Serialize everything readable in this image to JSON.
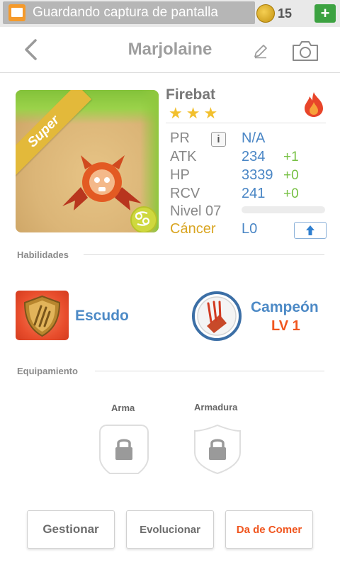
{
  "status_bar": {
    "toast_text": "Guardando captura de pantalla",
    "coins": "15",
    "plus_label": "+"
  },
  "header": {
    "title": "Marjolaine"
  },
  "creature": {
    "badge": "Super",
    "name": "Firebat",
    "stars": 3,
    "element_icon": "fire-icon",
    "stats": [
      {
        "label": "PR",
        "value": "N/A",
        "bonus": ""
      },
      {
        "label": "ATK",
        "value": "234",
        "bonus": "+1"
      },
      {
        "label": "HP",
        "value": "3339",
        "bonus": "+0"
      },
      {
        "label": "RCV",
        "value": "241",
        "bonus": "+0"
      }
    ],
    "level_label": "Nivel 07",
    "level_progress": 0,
    "zodiac": "Cáncer",
    "rank": "L0"
  },
  "skills": {
    "section_title": "Habilidades",
    "items": [
      {
        "name": "Escudo",
        "level": "",
        "icon": "shield-skill-icon"
      },
      {
        "name": "Campeón",
        "level": "LV 1",
        "icon": "champion-skill-icon"
      }
    ]
  },
  "equipment": {
    "section_title": "Equipamiento",
    "slots": [
      {
        "label": "Arma",
        "icon": "lock-icon"
      },
      {
        "label": "Armadura",
        "icon": "lock-icon"
      }
    ]
  },
  "actions": {
    "manage": "Gestionar",
    "evolve": "Evolucionar",
    "feed": "Da de Comer"
  },
  "colors": {
    "accent_blue": "#4a86c5",
    "bonus_green": "#76c043",
    "zodiac_gold": "#d9a521",
    "feed_orange": "#f0561f",
    "star_gold": "#f2c02e"
  }
}
